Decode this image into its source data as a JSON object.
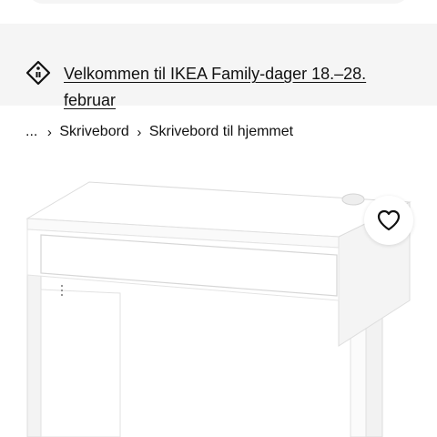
{
  "promo_banner": {
    "text": "Velkommen til IKEA Family-dager 18.–28. februar",
    "icon": "price-tag-icon"
  },
  "breadcrumb": {
    "ellipsis": "...",
    "items": [
      {
        "label": "Skrivebord"
      },
      {
        "label": "Skrivebord til hjemmet"
      }
    ],
    "separator_icon": "chevron-right-icon"
  },
  "product": {
    "image": "white-desk-with-drawer",
    "favorite_icon": "heart-outline-icon"
  },
  "colors": {
    "banner_bg": "#f5f5f5",
    "text": "#111111"
  }
}
